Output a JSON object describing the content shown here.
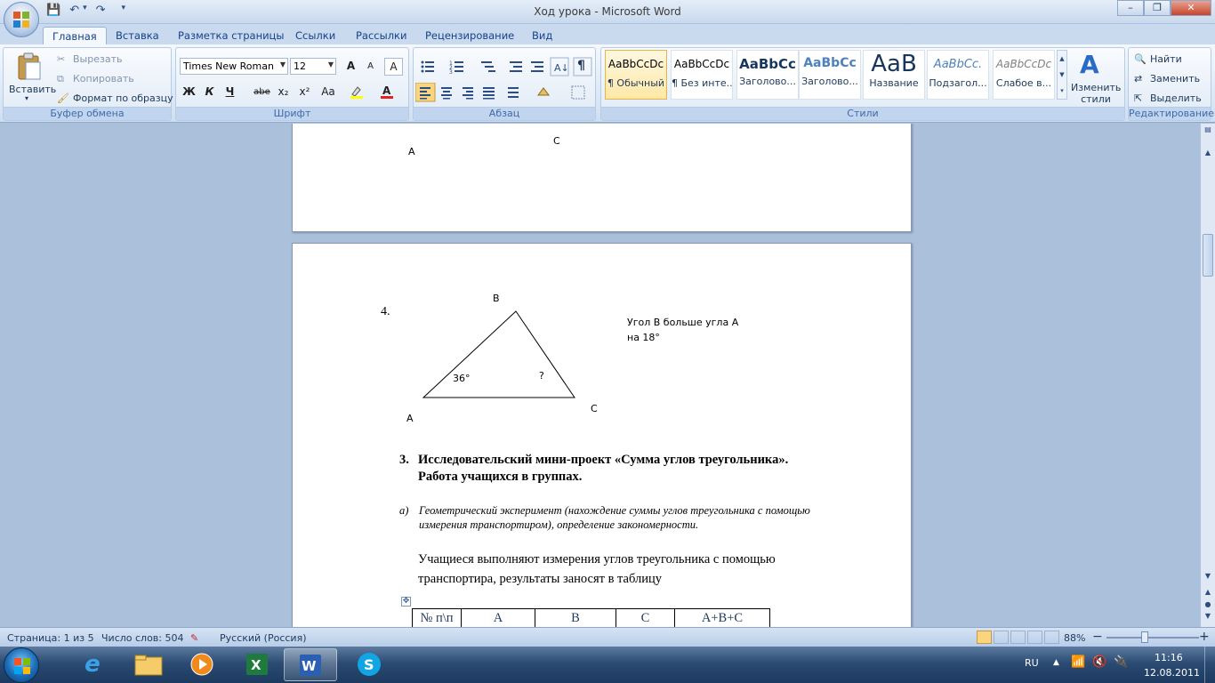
{
  "window": {
    "title": "Ход урока - Microsoft Word",
    "controls": {
      "minimize": "–",
      "restore": "❐",
      "close": "✕"
    }
  },
  "quick_access": {
    "save": "💾",
    "undo": "↶",
    "redo": "↷",
    "more": "▾"
  },
  "tabs": [
    "Главная",
    "Вставка",
    "Разметка страницы",
    "Ссылки",
    "Рассылки",
    "Рецензирование",
    "Вид"
  ],
  "ribbon": {
    "clipboard": {
      "label": "Буфер обмена",
      "paste": "Вставить",
      "cut": "Вырезать",
      "copy": "Копировать",
      "format_painter": "Формат по образцу"
    },
    "font": {
      "label": "Шрифт",
      "family": "Times New Roman",
      "size": "12",
      "bold": "Ж",
      "italic": "К",
      "underline": "Ч",
      "strike": "abe",
      "subscript": "x₂",
      "superscript": "x²",
      "case": "Aa",
      "grow": "A",
      "shrink": "A",
      "clear": "A"
    },
    "paragraph": {
      "label": "Абзац",
      "pilcrow": "¶"
    },
    "styles": {
      "label": "Стили",
      "items": [
        {
          "preview": "AaBbCcDc",
          "name": "¶ Обычный"
        },
        {
          "preview": "AaBbCcDc",
          "name": "¶ Без инте..."
        },
        {
          "preview": "AaBbCc",
          "name": "Заголово..."
        },
        {
          "preview": "AaBbCc",
          "name": "Заголово..."
        },
        {
          "preview": "AaB",
          "name": "Название"
        },
        {
          "preview": "AaBbCc.",
          "name": "Подзагол..."
        },
        {
          "preview": "AaBbCcDc",
          "name": "Слабое в..."
        }
      ],
      "change_styles": "Изменить стили"
    },
    "editing": {
      "label": "Редактирование",
      "find": "Найти",
      "replace": "Заменить",
      "select": "Выделить"
    }
  },
  "document": {
    "page1": {
      "label_a": "A",
      "label_c": "C"
    },
    "page2": {
      "item_number": "4.",
      "vertex_a": "A",
      "vertex_b": "B",
      "vertex_c": "C",
      "angle_a": "36°",
      "angle_unknown": "?",
      "condition_line1": "Угол В больше угла  А",
      "condition_line2": "на 18°",
      "section_number": "3.",
      "section_title_line1": "Исследовательский  мини-проект  «Сумма углов треугольника».",
      "section_title_line2": "Работа учащихся  в группах.",
      "sub_marker": "а)",
      "sub_line1": "Геометрический эксперимент (нахождение суммы углов треугольника с помощью",
      "sub_line2": "измерения транспортиром), определение закономерности.",
      "body_line1": "Учащиеся выполняют измерения углов треугольника с помощью",
      "body_line2": "транспортира, результаты заносят в таблицу",
      "table_headers": [
        "№ п\\п",
        "A",
        "B",
        "C",
        "A+B+C"
      ]
    }
  },
  "status": {
    "page": "Страница: 1 из 5",
    "words": "Число слов: 504",
    "language": "Русский (Россия)",
    "zoom": "88%",
    "zoom_minus": "−",
    "zoom_plus": "+"
  },
  "taskbar": {
    "lang": "RU",
    "time": "11:16",
    "date": "12.08.2011"
  }
}
